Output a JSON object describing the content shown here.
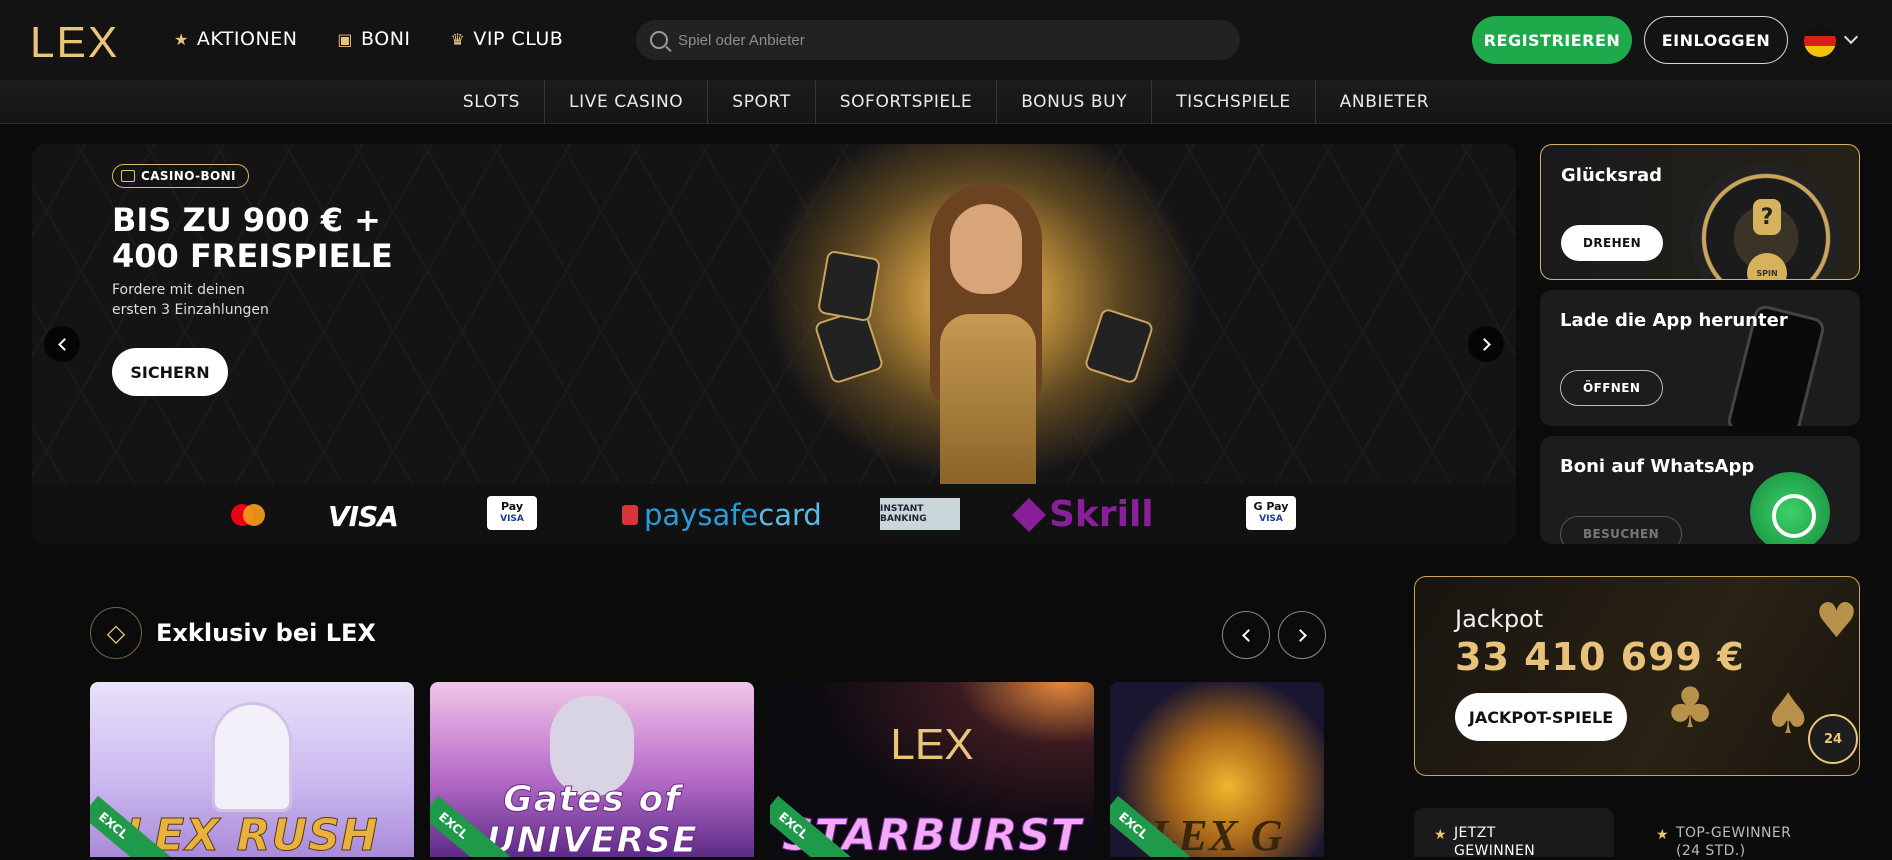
{
  "logo": "LEX",
  "nav": [
    {
      "label": "AKTIONEN",
      "icon": "star-icon"
    },
    {
      "label": "BONI",
      "icon": "gift-icon"
    },
    {
      "label": "VIP CLUB",
      "icon": "crown-icon"
    }
  ],
  "search": {
    "placeholder": "Spiel oder Anbieter"
  },
  "auth": {
    "register": "REGISTRIEREN",
    "login": "EINLOGGEN"
  },
  "language": {
    "flag": "de-flag-icon"
  },
  "categories": [
    "SLOTS",
    "LIVE CASINO",
    "SPORT",
    "SOFORTSPIELE",
    "BONUS BUY",
    "TISCHSPIELE",
    "ANBIETER"
  ],
  "hero": {
    "badge": "CASINO-BONI",
    "title_line1": "BIS ZU 900 € +",
    "title_line2": "400 FREISPIELE",
    "sub_line1": "Fordere mit deinen",
    "sub_line2": "ersten 3 Einzahlungen",
    "button": "SICHERN"
  },
  "payments": {
    "visa": "VISA",
    "applepay_line1": "Pay",
    "applepay_line2": "VISA",
    "paysafe_a": "paysafe",
    "paysafe_b": "card",
    "rapid": "INSTANT BANKING",
    "skrill": "Skrill",
    "gpay_line1": "G Pay",
    "gpay_line2": "VISA"
  },
  "side_cards": {
    "wheel": {
      "title": "Glücksrad",
      "button": "DREHEN",
      "spin": "SPIN",
      "q": "?"
    },
    "app": {
      "title": "Lade die App herunter",
      "button": "ÖFFNEN"
    },
    "whatsapp": {
      "title": "Boni auf WhatsApp",
      "button": "BESUCHEN"
    }
  },
  "exclusive": {
    "title": "Exklusiv bei LEX",
    "games": [
      {
        "name": "LEX RUSH",
        "ribbon": "EXCL"
      },
      {
        "name": "Gates of UNIVERSE",
        "ribbon": "EXCL"
      },
      {
        "name": "STARBURST",
        "ribbon": "EXCL",
        "top": "LEX"
      },
      {
        "name": "LEX G",
        "ribbon": "EXCL"
      }
    ]
  },
  "jackpot": {
    "label": "Jackpot",
    "amount": "33 410 699 €",
    "button": "JACKPOT-SPIELE"
  },
  "support": {
    "label": "24"
  },
  "winners": {
    "tab1_line1": "JETZT",
    "tab1_line2": "GEWINNEN",
    "tab2_line1": "TOP-GEWINNER",
    "tab2_line2": "(24 STD.)"
  },
  "colors": {
    "accent_gold": "#e9c57a",
    "green": "#1eaa4a",
    "bg": "#0b0b0c"
  }
}
